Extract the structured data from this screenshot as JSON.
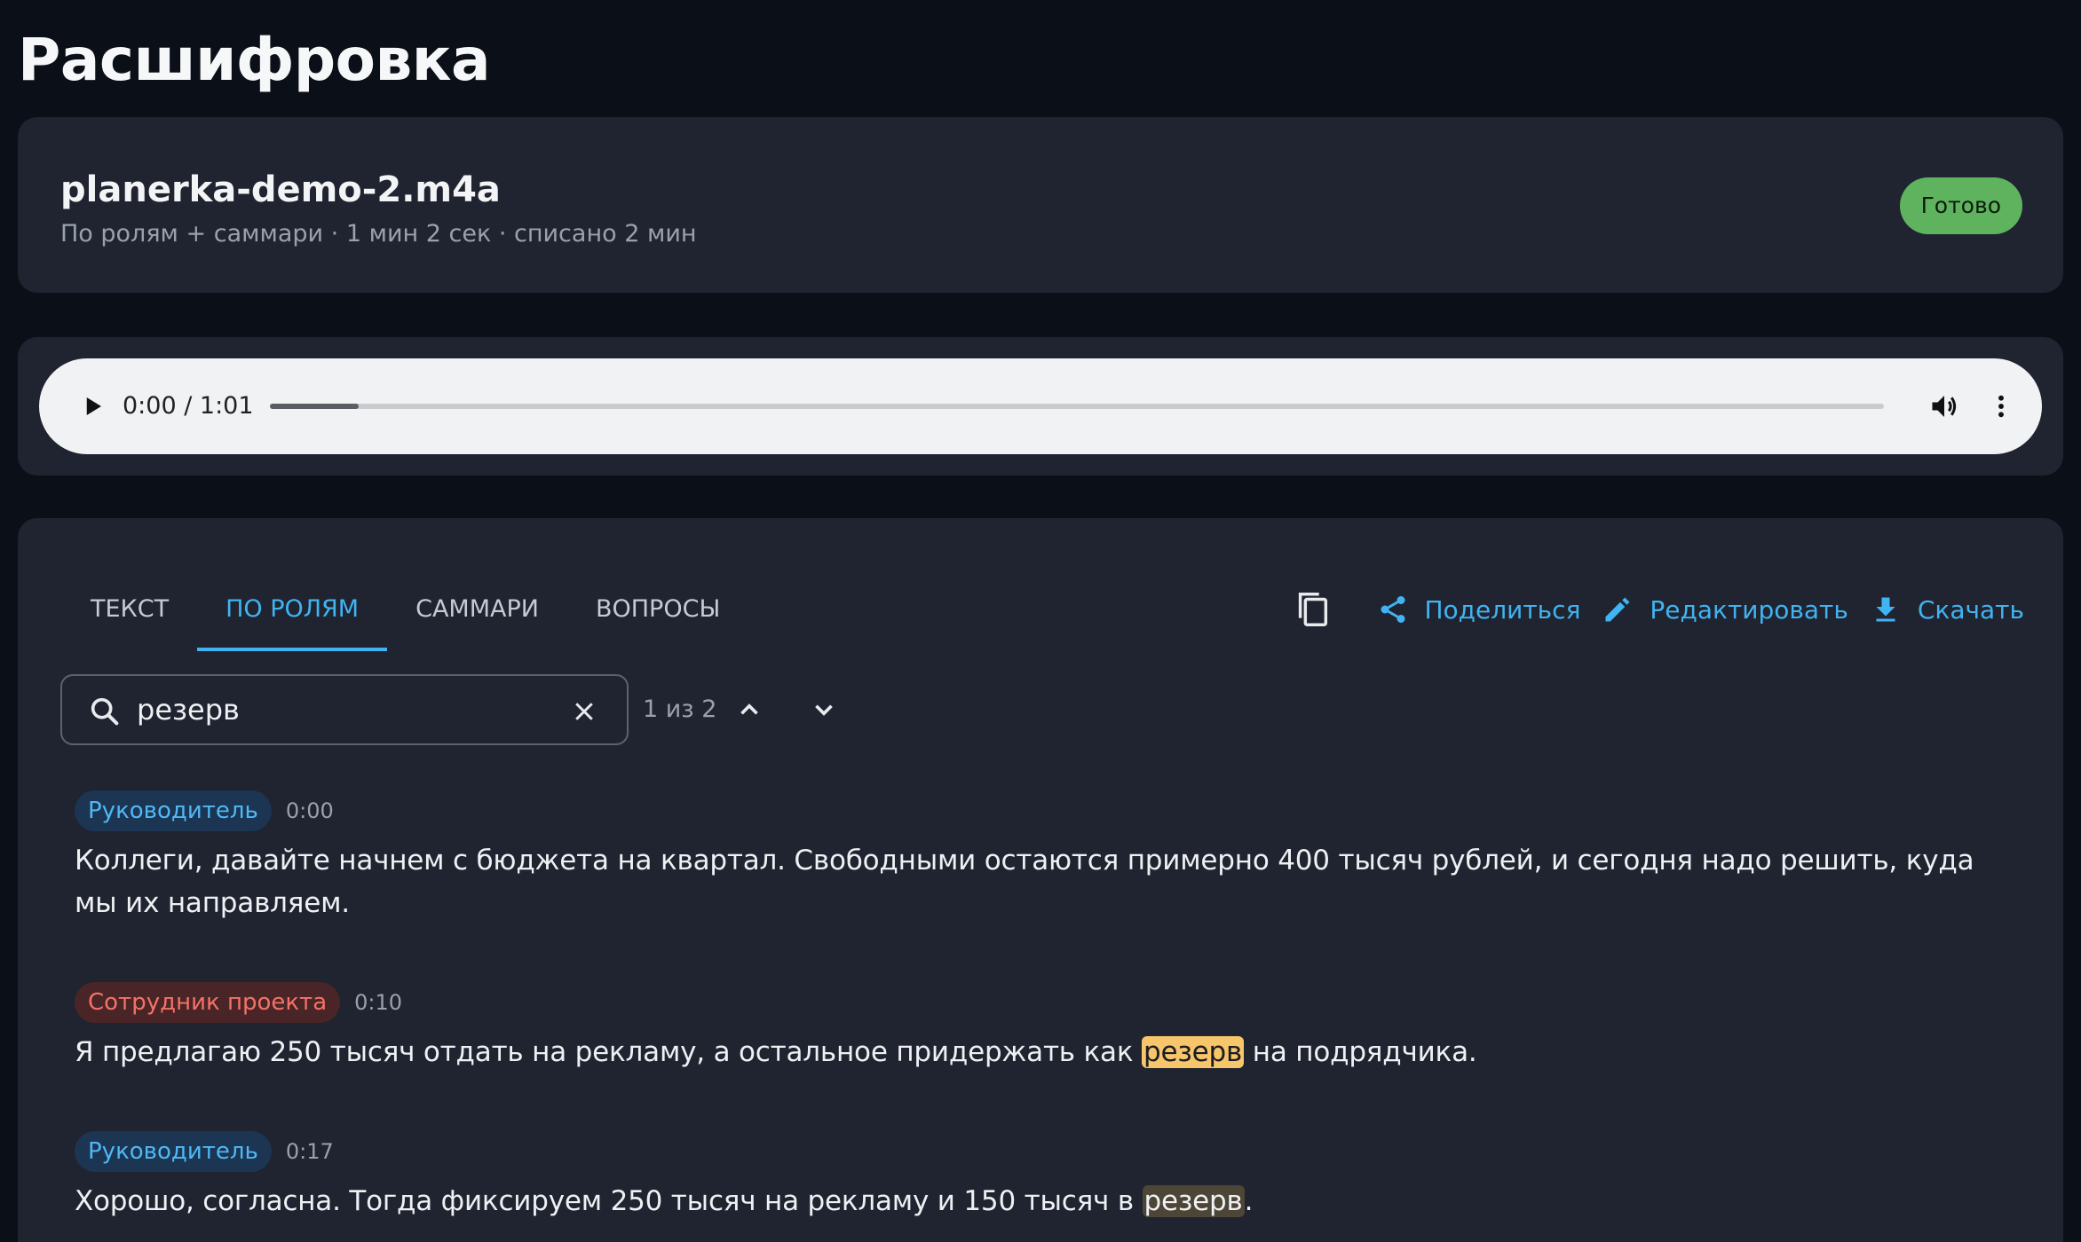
{
  "page": {
    "title": "Расшифровка"
  },
  "file": {
    "name": "planerka-demo-2.m4a",
    "meta": "По ролям + саммари · 1 мин 2 сек · списано 2 мин",
    "status": "Готово",
    "status_color": "#5fb35f"
  },
  "player": {
    "time": "0:00 / 1:01",
    "buffered_fraction": 0.055,
    "icons": [
      "play-icon",
      "volume-icon",
      "more-vert-icon"
    ]
  },
  "tabs": [
    {
      "label": "ТЕКСТ",
      "active": false
    },
    {
      "label": "ПО РОЛЯМ",
      "active": true
    },
    {
      "label": "САММАРИ",
      "active": false
    },
    {
      "label": "ВОПРОСЫ",
      "active": false
    }
  ],
  "actions": {
    "copy_icon": "copy-icon",
    "share": "Поделиться",
    "edit": "Редактировать",
    "download": "Скачать",
    "accent_color": "#41b3f2"
  },
  "search": {
    "value": "резерв",
    "counter": "1 из 2"
  },
  "utterances": [
    {
      "speaker": "Руководитель",
      "time": "0:00",
      "text_before": "Коллеги, давайте начнем с бюджета на квартал. Свободными остаются примерно 400 тысяч рублей, и сегодня надо решить, куда мы их направляем.",
      "highlight": "",
      "text_after": ""
    },
    {
      "speaker": "Сотрудник проекта",
      "time": "0:10",
      "text_before": "Я предлагаю 250 тысяч отдать на рекламу, а остальное придержать как ",
      "highlight": "резерв",
      "text_after": " на подрядчика."
    },
    {
      "speaker": "Руководитель",
      "time": "0:17",
      "text_before": "Хорошо, согласна. Тогда фиксируем 250 тысяч на рекламу и 150 тысяч в ",
      "highlight": "резерв",
      "text_after": "."
    }
  ]
}
